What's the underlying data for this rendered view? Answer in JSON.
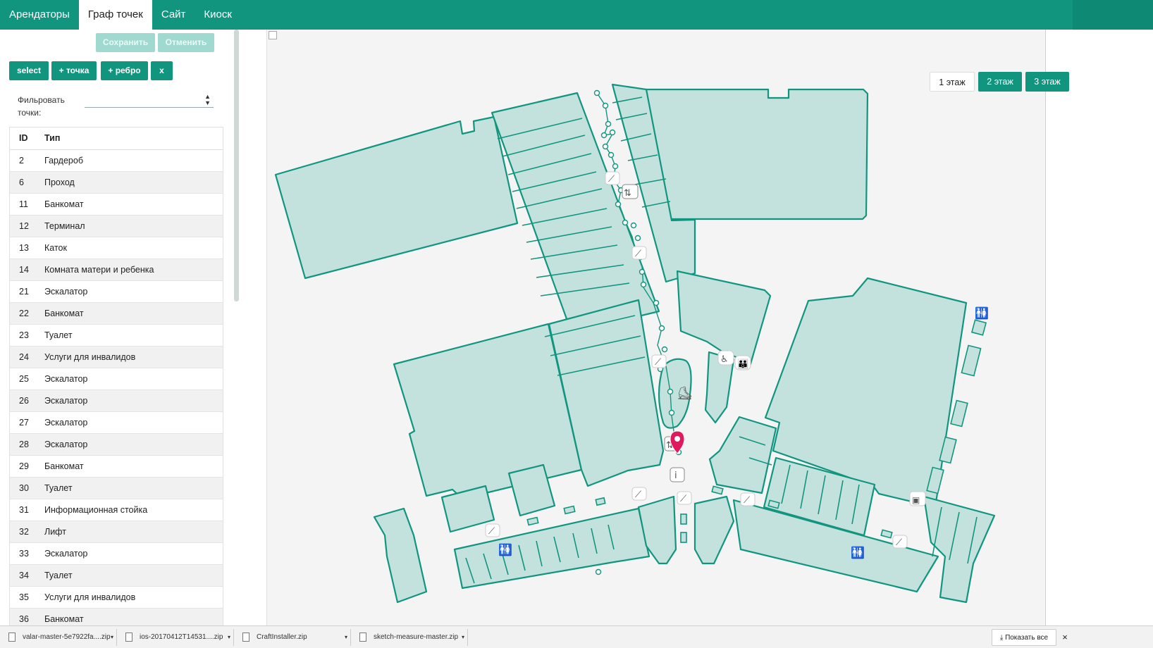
{
  "nav": {
    "tabs": [
      {
        "label": "Арендаторы"
      },
      {
        "label": "Граф точек"
      },
      {
        "label": "Сайт"
      },
      {
        "label": "Киоск"
      }
    ],
    "active_tab": "Граф точек"
  },
  "editor": {
    "save_label": "Сохранить",
    "cancel_label": "Отменить",
    "tools": {
      "select": "select",
      "add_point": "+ точка",
      "add_edge": "+ ребро",
      "delete": "x"
    },
    "filter_label": "Фильровать точки:",
    "filter_value": ""
  },
  "points_table": {
    "headers": {
      "id": "ID",
      "type": "Тип"
    },
    "rows": [
      {
        "id": "2",
        "type": "Гардероб"
      },
      {
        "id": "6",
        "type": "Проход"
      },
      {
        "id": "11",
        "type": "Банкомат"
      },
      {
        "id": "12",
        "type": "Терминал"
      },
      {
        "id": "13",
        "type": "Каток"
      },
      {
        "id": "14",
        "type": "Комната матери и ребенка"
      },
      {
        "id": "21",
        "type": "Эскалатор"
      },
      {
        "id": "22",
        "type": "Банкомат"
      },
      {
        "id": "23",
        "type": "Туалет"
      },
      {
        "id": "24",
        "type": "Услуги для инвалидов"
      },
      {
        "id": "25",
        "type": "Эскалатор"
      },
      {
        "id": "26",
        "type": "Эскалатор"
      },
      {
        "id": "27",
        "type": "Эскалатор"
      },
      {
        "id": "28",
        "type": "Эскалатор"
      },
      {
        "id": "29",
        "type": "Банкомат"
      },
      {
        "id": "30",
        "type": "Туалет"
      },
      {
        "id": "31",
        "type": "Информационная стойка"
      },
      {
        "id": "32",
        "type": "Лифт"
      },
      {
        "id": "33",
        "type": "Эскалатор"
      },
      {
        "id": "34",
        "type": "Туалет"
      },
      {
        "id": "35",
        "type": "Услуги для инвалидов"
      },
      {
        "id": "36",
        "type": "Банкомат"
      }
    ]
  },
  "map": {
    "floors": [
      {
        "label": "1 этаж",
        "active": false
      },
      {
        "label": "2 этаж",
        "active": true
      },
      {
        "label": "3 этаж",
        "active": true
      }
    ],
    "colors": {
      "fill": "#c3e2de",
      "stroke": "#12957f",
      "marker": "#e0195f"
    }
  },
  "downloads": {
    "items": [
      {
        "name": "valar-master-5e7922fa....zip"
      },
      {
        "name": "ios-20170412T14531....zip"
      },
      {
        "name": "CraftInstaller.zip"
      },
      {
        "name": "sketch-measure-master.zip"
      }
    ],
    "show_all": "Показать все",
    "close": "×"
  }
}
